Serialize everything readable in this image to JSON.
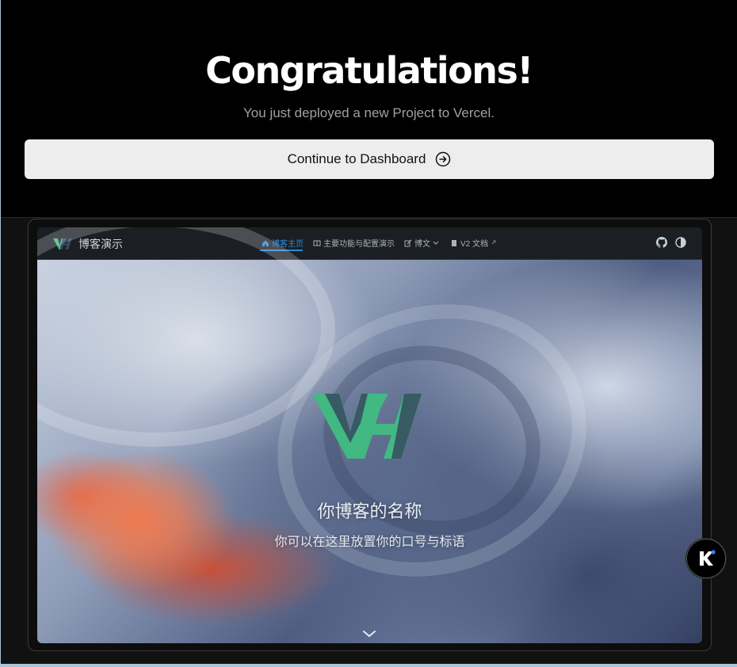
{
  "header": {
    "title": "Congratulations!",
    "subtitle": "You just deployed a new Project to Vercel."
  },
  "continue_button": {
    "label": "Continue to Dashboard",
    "icon": "arrow-right-circle-icon"
  },
  "preview": {
    "site_name": "博客演示",
    "nav": [
      {
        "label": "博客主页",
        "icon": "home-icon",
        "active": true
      },
      {
        "label": "主要功能与配置演示",
        "icon": "book-icon",
        "active": false
      },
      {
        "label": "博文",
        "icon": "edit-icon",
        "active": false,
        "dropdown": true
      },
      {
        "label": "V2 文档",
        "icon": "document-icon",
        "active": false,
        "external": true
      }
    ],
    "nav_right_icons": [
      "github-icon",
      "theme-toggle-icon"
    ],
    "hero_name": "你博客的名称",
    "hero_slogan": "你可以在这里放置你的口号与标语",
    "accent_color": "#2e8bd6",
    "logo_colors": {
      "green": "#42b883",
      "dark": "#35495e"
    }
  },
  "badge": {
    "icon": "k-logo-icon"
  }
}
